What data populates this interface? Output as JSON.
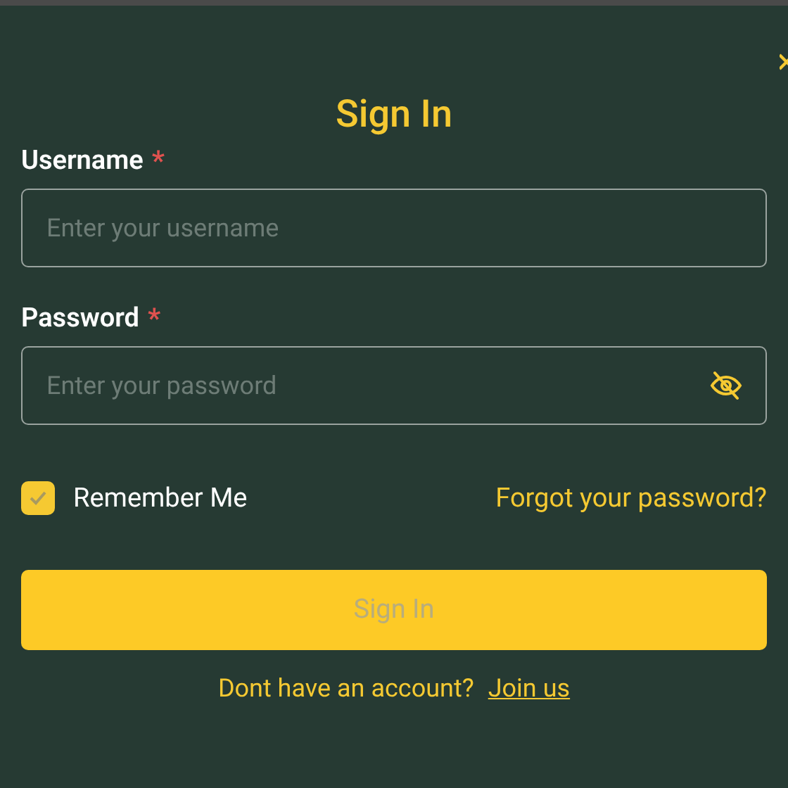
{
  "title": "Sign In",
  "fields": [
    {
      "label": "Username",
      "required": true,
      "placeholder": "Enter your username",
      "kind": "text"
    },
    {
      "label": "Password",
      "required": true,
      "placeholder": "Enter your password",
      "kind": "password"
    }
  ],
  "required_mark": "*",
  "remember": {
    "label": "Remember Me",
    "checked": true
  },
  "forgot_link": "Forgot your password?",
  "submit": {
    "label": "Sign In",
    "disabled": true
  },
  "footer": {
    "text": "Dont have an account?",
    "link": "Join us"
  }
}
